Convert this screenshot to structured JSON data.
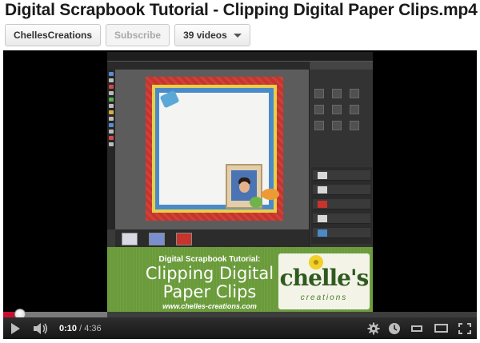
{
  "page": {
    "title": "Digital Scrapbook Tutorial - Clipping Digital Paper Clips.mp4"
  },
  "channel": {
    "name": "ChellesCreations",
    "subscribe_label": "Subscribe",
    "videos_label": "39 videos"
  },
  "video": {
    "promo_line1": "Digital Scrapbook Tutorial:",
    "promo_line2": "Clipping Digital",
    "promo_line3": "Paper Clips",
    "promo_url": "www.chelles-creations.com",
    "logo_name": "chelle's",
    "logo_sub": "creations"
  },
  "player": {
    "current_time": "0:10",
    "separator": " / ",
    "duration": "4:36",
    "played_fraction": 0.036,
    "buffered_fraction": 0.22,
    "icons": [
      "play-icon",
      "volume-icon",
      "gear-icon",
      "clock-icon",
      "small-player-icon",
      "large-player-icon",
      "fullscreen-icon"
    ]
  },
  "colors": {
    "progress": "#c8102e",
    "promo_bg": "#6a9b3a",
    "paper_red": "#c8332c"
  }
}
